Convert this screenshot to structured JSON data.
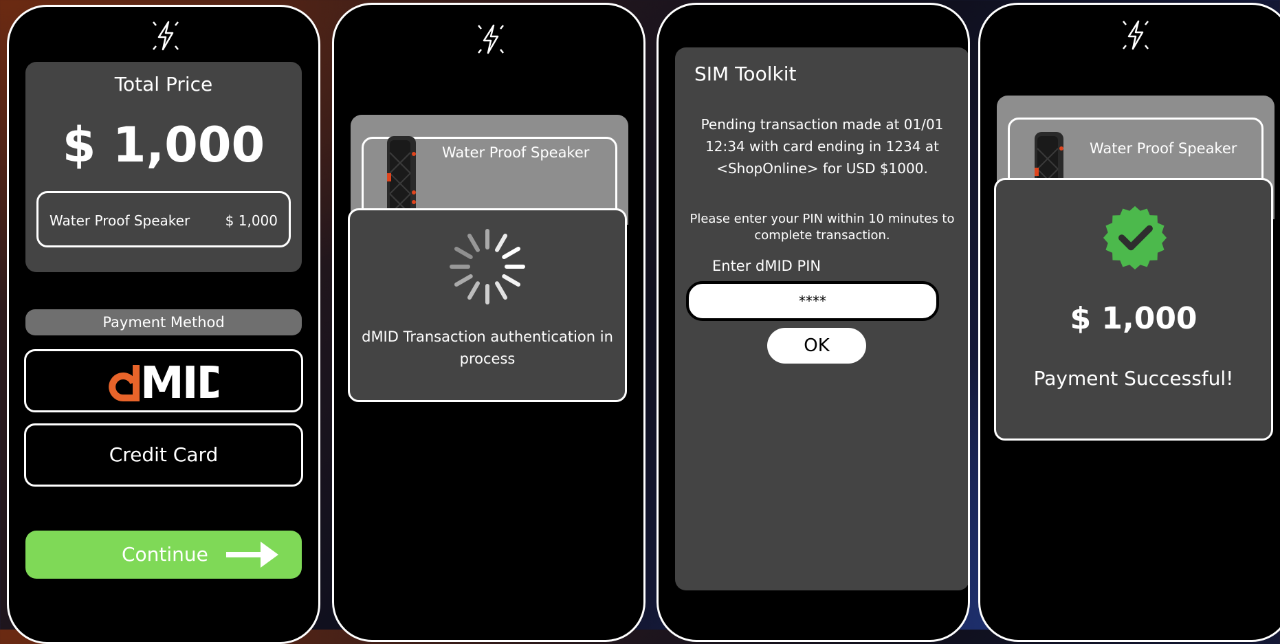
{
  "colors": {
    "panel": "#444444",
    "accent_green": "#7fd957",
    "success_green": "#4cb94c",
    "dmid_orange": "#e8642a",
    "speaker_red": "#e0451e"
  },
  "icons": {
    "nfc": "nfc-off-icon",
    "arrow": "arrow-right-icon",
    "spinner": "loading-spinner-icon",
    "check": "check-badge-icon"
  },
  "screen1": {
    "total_price_label": "Total Price",
    "total_price": "$ 1,000",
    "item_name": "Water Proof Speaker",
    "item_price": "$ 1,000",
    "payment_method_label": "Payment Method",
    "dmid_logo": "dMID",
    "credit_card_label": "Credit Card",
    "continue_label": "Continue"
  },
  "screen2": {
    "item_name": "Water Proof Speaker",
    "status_message": "dMID Transaction authentication in process"
  },
  "screen3": {
    "title": "SIM Toolkit",
    "pending_message": "Pending transaction made at 01/01 12:34 with card ending in 1234 at <ShopOnline> for USD $1000.",
    "instruction": "Please enter your PIN within 10 minutes to complete transaction.",
    "pin_label": "Enter dMID PIN",
    "pin_value": "****",
    "ok_label": "OK"
  },
  "screen4": {
    "item_name": "Water Proof Speaker",
    "amount": "$ 1,000",
    "success_message": "Payment Successful!"
  }
}
